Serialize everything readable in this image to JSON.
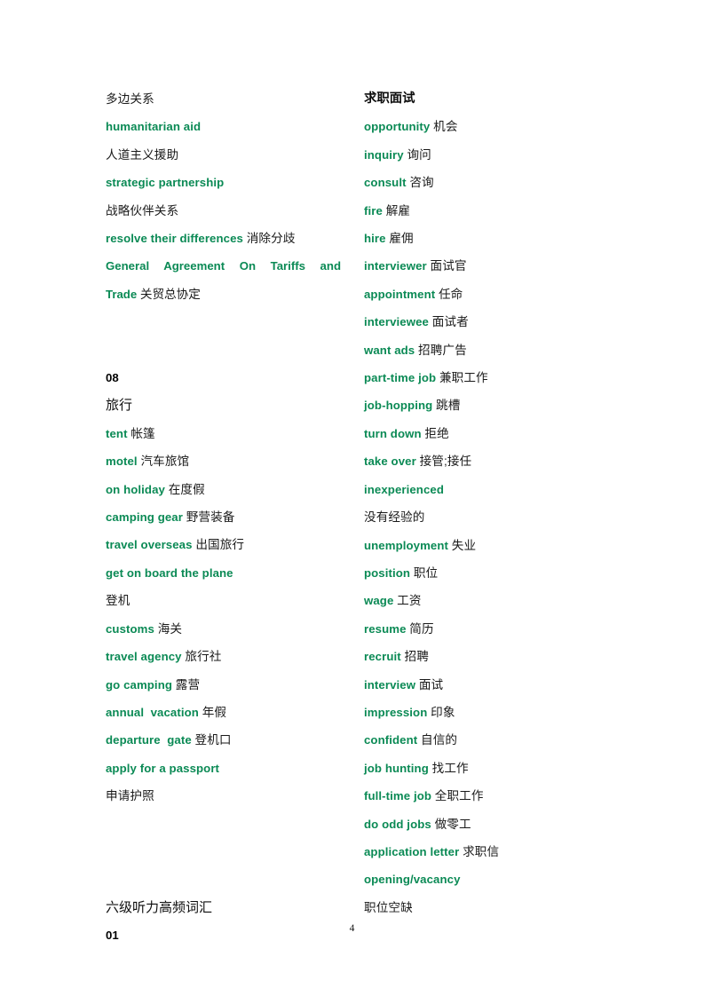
{
  "document": {
    "page_number": "4",
    "accent_color": "#0b8a55",
    "text_color": "#1a1a1a"
  },
  "left_column": {
    "entries": [
      {
        "type": "zh",
        "zh": "多边关系"
      },
      {
        "type": "en",
        "en": "humanitarian aid"
      },
      {
        "type": "zh",
        "zh": "人道主义援助"
      },
      {
        "type": "en",
        "en": "strategic partnership"
      },
      {
        "type": "zh",
        "zh": "战略伙伴关系"
      },
      {
        "type": "pair",
        "en": "resolve their differences",
        "zh": "消除分歧"
      },
      {
        "type": "justified",
        "en_line1": "General Agreement On Tariffs and",
        "en_line2": "Trade",
        "zh": "关贸总协定"
      },
      {
        "type": "gap_lg"
      },
      {
        "type": "num",
        "num": "08"
      },
      {
        "type": "heading",
        "zh": "旅行"
      },
      {
        "type": "pair",
        "en": "tent",
        "zh": "帐篷"
      },
      {
        "type": "pair",
        "en": "motel",
        "zh": "汽车旅馆"
      },
      {
        "type": "pair",
        "en": "on holiday",
        "zh": "在度假"
      },
      {
        "type": "pair",
        "en": "camping gear",
        "zh": "野营装备"
      },
      {
        "type": "pair",
        "en": "travel overseas",
        "zh": "出国旅行"
      },
      {
        "type": "en",
        "en": "get on board the plane"
      },
      {
        "type": "zh",
        "zh": "登机"
      },
      {
        "type": "pair",
        "en": "customs",
        "zh": "海关"
      },
      {
        "type": "pair",
        "en": "travel agency",
        "zh": "旅行社"
      },
      {
        "type": "pair",
        "en": "go camping",
        "zh": "露营"
      },
      {
        "type": "pair",
        "en": "annual  vacation",
        "zh": "年假"
      },
      {
        "type": "pair",
        "en": "departure  gate",
        "zh": "登机口"
      },
      {
        "type": "en",
        "en": "apply for a passport"
      },
      {
        "type": "zh",
        "zh": "申请护照"
      },
      {
        "type": "gap_xl"
      },
      {
        "type": "heading",
        "zh": "六级听力高频词汇"
      },
      {
        "type": "num",
        "num": "01"
      }
    ]
  },
  "right_column": {
    "entries": [
      {
        "type": "heading_bold",
        "zh": "求职面试"
      },
      {
        "type": "pair",
        "en": "opportunity",
        "zh": "机会"
      },
      {
        "type": "pair",
        "en": "inquiry",
        "zh": "询问"
      },
      {
        "type": "pair",
        "en": "consult",
        "zh": "咨询"
      },
      {
        "type": "pair",
        "en": "fire",
        "zh": "解雇"
      },
      {
        "type": "pair",
        "en": "hire",
        "zh": "雇佣"
      },
      {
        "type": "pair",
        "en": "interviewer",
        "zh": "面试官"
      },
      {
        "type": "pair",
        "en": "appointment",
        "zh": "任命"
      },
      {
        "type": "pair",
        "en": "interviewee",
        "zh": "面试者"
      },
      {
        "type": "pair",
        "en": "want ads",
        "zh": "招聘广告"
      },
      {
        "type": "pair",
        "en": "part-time job",
        "zh": "兼职工作"
      },
      {
        "type": "pair",
        "en": "job-hopping",
        "zh": "跳槽"
      },
      {
        "type": "pair",
        "en": "turn down",
        "zh": "拒绝"
      },
      {
        "type": "pair",
        "en": "take over",
        "zh": "接管;接任"
      },
      {
        "type": "en",
        "en": "inexperienced"
      },
      {
        "type": "zh",
        "zh": "没有经验的"
      },
      {
        "type": "pair",
        "en": "unemployment",
        "zh": "失业"
      },
      {
        "type": "pair",
        "en": "position",
        "zh": "职位"
      },
      {
        "type": "pair",
        "en": "wage",
        "zh": "工资"
      },
      {
        "type": "pair",
        "en": "resume",
        "zh": "简历"
      },
      {
        "type": "pair",
        "en": "recruit",
        "zh": "招聘"
      },
      {
        "type": "pair",
        "en": "interview",
        "zh": "面试"
      },
      {
        "type": "pair",
        "en": "impression",
        "zh": "印象"
      },
      {
        "type": "pair",
        "en": "confident",
        "zh": "自信的"
      },
      {
        "type": "pair",
        "en": "job hunting",
        "zh": "找工作"
      },
      {
        "type": "pair",
        "en": "full-time job",
        "zh": "全职工作"
      },
      {
        "type": "pair",
        "en": "do odd jobs",
        "zh": "做零工"
      },
      {
        "type": "pair",
        "en": "application letter",
        "zh": "求职信"
      },
      {
        "type": "en",
        "en": "opening/vacancy"
      },
      {
        "type": "zh",
        "zh": "职位空缺"
      }
    ]
  }
}
